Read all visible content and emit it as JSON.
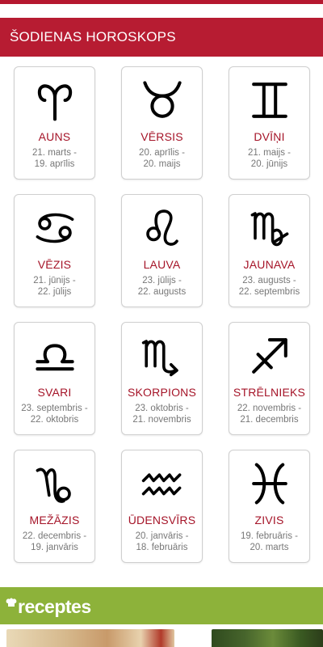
{
  "section": {
    "title": "ŠODIENAS HOROSKOPS"
  },
  "signs": [
    {
      "name": "AUNS",
      "dates_line1": "21. marts -",
      "dates_line2": "19. aprīlis",
      "icon": "aries-icon"
    },
    {
      "name": "VĒRSIS",
      "dates_line1": "20. aprīlis -",
      "dates_line2": "20. maijs",
      "icon": "taurus-icon"
    },
    {
      "name": "DVĪŅI",
      "dates_line1": "21. maijs -",
      "dates_line2": "20. jūnijs",
      "icon": "gemini-icon"
    },
    {
      "name": "VĒZIS",
      "dates_line1": "21. jūnijs -",
      "dates_line2": "22. jūlijs",
      "icon": "cancer-icon"
    },
    {
      "name": "LAUVA",
      "dates_line1": "23. jūlijs -",
      "dates_line2": "22. augusts",
      "icon": "leo-icon"
    },
    {
      "name": "JAUNAVA",
      "dates_line1": "23. augusts -",
      "dates_line2": "22. septembris",
      "icon": "virgo-icon"
    },
    {
      "name": "SVARI",
      "dates_line1": "23. septembris -",
      "dates_line2": "22. oktobris",
      "icon": "libra-icon"
    },
    {
      "name": "SKORPIONS",
      "dates_line1": "23. oktobris -",
      "dates_line2": "21. novembris",
      "icon": "scorpio-icon"
    },
    {
      "name": "STRĒLNIEKS",
      "dates_line1": "22. novembris -",
      "dates_line2": "21. decembris",
      "icon": "sagittarius-icon"
    },
    {
      "name": "MEŽĀZIS",
      "dates_line1": "22. decembris -",
      "dates_line2": "19. janvāris",
      "icon": "capricorn-icon"
    },
    {
      "name": "ŪDENSVĪRS",
      "dates_line1": "20. janvāris -",
      "dates_line2": "18. februāris",
      "icon": "aquarius-icon"
    },
    {
      "name": "ZIVIS",
      "dates_line1": "19. februāris -",
      "dates_line2": "20. marts",
      "icon": "pisces-icon"
    }
  ],
  "recipes": {
    "logo_text": "receptes"
  },
  "colors": {
    "header_bg": "#b71c32",
    "sign_name": "#a51428",
    "dates_text": "#777777",
    "recipes_bar": "#8db23a"
  }
}
